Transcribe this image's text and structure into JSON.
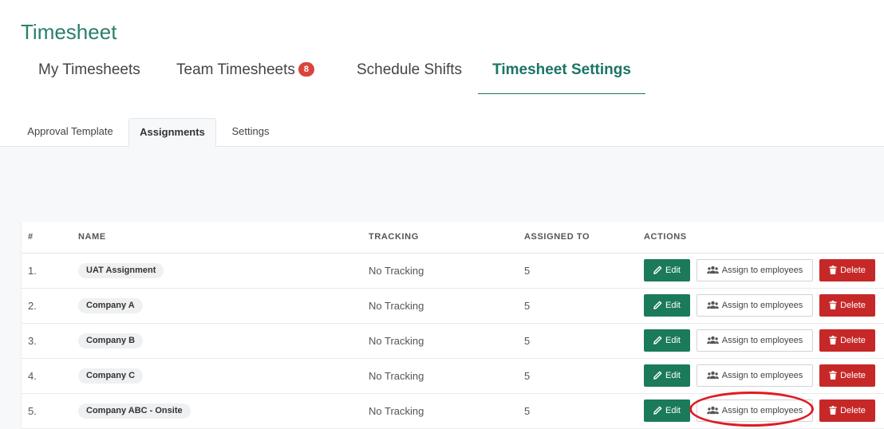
{
  "app": {
    "title": "Timesheet"
  },
  "main_tabs": [
    {
      "label": "My Timesheets"
    },
    {
      "label": "Team Timesheets",
      "badge": "8"
    },
    {
      "label": "Schedule Shifts"
    },
    {
      "label": "Timesheet Settings",
      "active": true
    }
  ],
  "sub_tabs": [
    {
      "label": "Approval Template"
    },
    {
      "label": "Assignments",
      "active": true
    },
    {
      "label": "Settings"
    }
  ],
  "table": {
    "columns": {
      "num": "#",
      "name": "NAME",
      "tracking": "TRACKING",
      "assigned_to": "ASSIGNED TO",
      "actions": "ACTIONS"
    },
    "rows": [
      {
        "num": "1.",
        "name": "UAT Assignment",
        "tracking": "No Tracking",
        "assigned_to": "5"
      },
      {
        "num": "2.",
        "name": "Company A",
        "tracking": "No Tracking",
        "assigned_to": "5"
      },
      {
        "num": "3.",
        "name": "Company B",
        "tracking": "No Tracking",
        "assigned_to": "5"
      },
      {
        "num": "4.",
        "name": "Company C",
        "tracking": "No Tracking",
        "assigned_to": "5"
      },
      {
        "num": "5.",
        "name": "Company ABC - Onsite",
        "tracking": "No Tracking",
        "assigned_to": "5"
      }
    ],
    "actions": {
      "edit": "Edit",
      "assign": "Assign to employees",
      "delete": "Delete"
    }
  },
  "icons": {
    "edit": "pencil-icon",
    "assign": "users-icon",
    "delete": "trash-icon"
  },
  "colors": {
    "brand": "#1a7564",
    "title": "#2a7f6c",
    "badge": "#d9453c",
    "edit_button": "#1a7a5a",
    "delete_button": "#c62828",
    "annotation": "#e01b24"
  }
}
